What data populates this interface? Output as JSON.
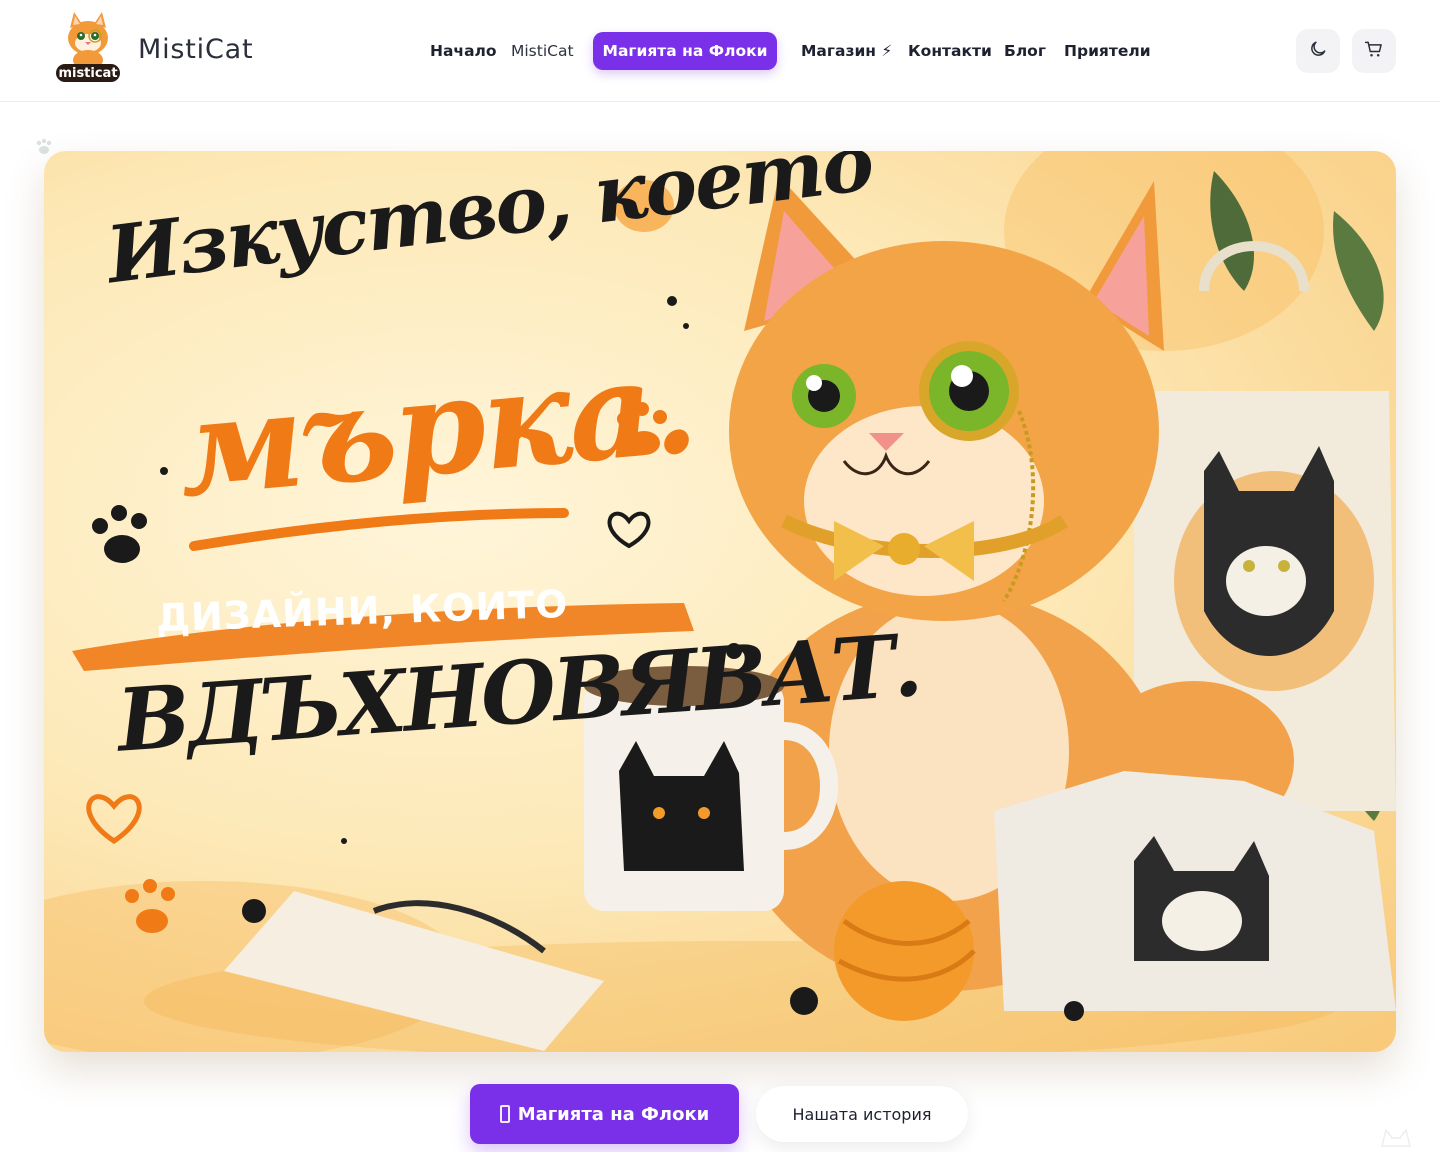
{
  "header": {
    "brand": "MistiCat",
    "logo_text": "misticat",
    "nav": [
      {
        "label": "Начало"
      },
      {
        "label": "MistiCat"
      },
      {
        "label": "Магията на Флоки",
        "active": true
      },
      {
        "label": "Магазин ⚡"
      },
      {
        "label": "Контакти"
      },
      {
        "label": "Блог"
      },
      {
        "label": "Приятели"
      }
    ],
    "icons": [
      "moon-icon",
      "cart-icon"
    ]
  },
  "hero": {
    "line1": "Изкуство, което",
    "line2": "мърка.",
    "line3": "ДИЗАЙНИ, КОИТО",
    "line4": "ВДЪХНОВЯВАТ."
  },
  "actions": {
    "primary_label": "Магията на Флоки",
    "secondary_label": "Нашата история"
  },
  "colors": {
    "accent": "#7a2fe8",
    "hero_orange": "#f07a16"
  }
}
